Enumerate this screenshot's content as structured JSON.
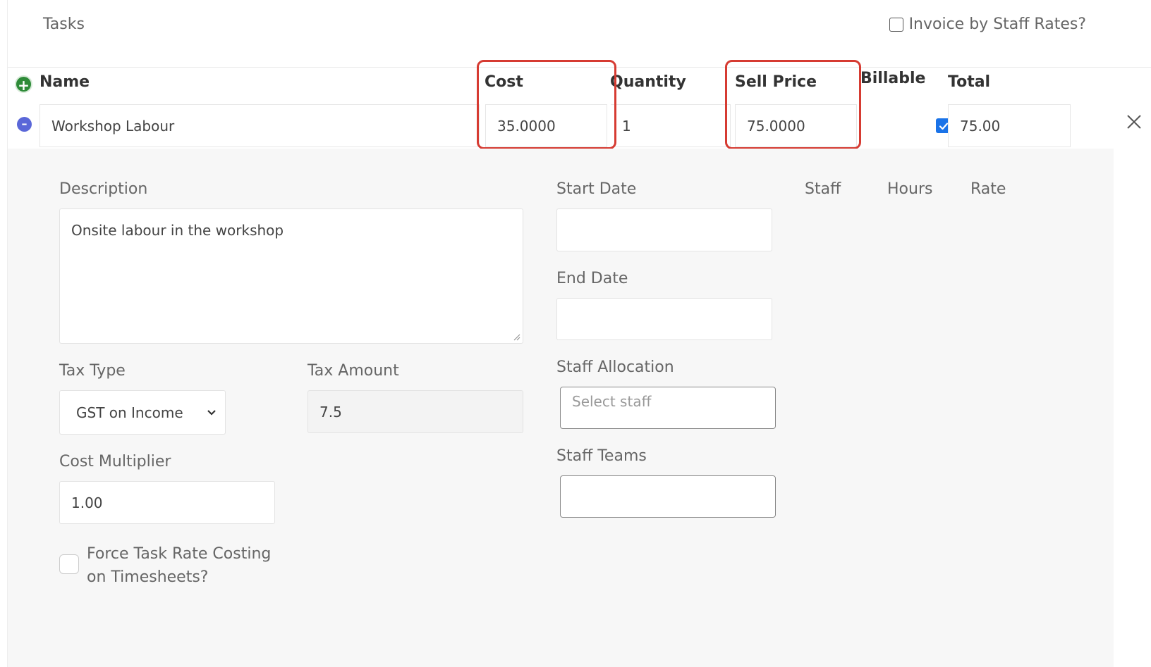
{
  "header": {
    "title": "Tasks",
    "invoice_by_staff_label": "Invoice by Staff Rates?"
  },
  "columns": {
    "name": "Name",
    "cost": "Cost",
    "quantity": "Quantity",
    "sell_price": "Sell Price",
    "billable": "Billable",
    "total": "Total"
  },
  "task_row": {
    "name": "Workshop Labour",
    "cost": "35.0000",
    "quantity": "1",
    "sell_price": "75.0000",
    "billable": true,
    "total": "75.00"
  },
  "details": {
    "description_label": "Description",
    "description_value": "Onsite labour in the workshop",
    "start_date_label": "Start Date",
    "end_date_label": "End Date",
    "staff_label": "Staff",
    "hours_label": "Hours",
    "rate_label": "Rate",
    "tax_type_label": "Tax Type",
    "tax_type_value": "GST on Income",
    "tax_amount_label": "Tax Amount",
    "tax_amount_value": "7.5",
    "staff_allocation_label": "Staff Allocation",
    "staff_allocation_placeholder": "Select staff",
    "cost_multiplier_label": "Cost Multiplier",
    "cost_multiplier_value": "1.00",
    "staff_teams_label": "Staff Teams",
    "force_rate_label_line1": "Force Task Rate Costing",
    "force_rate_label_line2": "on Timesheets?"
  },
  "colors": {
    "highlight": "#d63b32",
    "add_icon": "#2e8b38",
    "remove_icon": "#5a67d8",
    "checkbox_checked": "#1a73e8"
  },
  "icons": {
    "add": "plus-circle-icon",
    "remove": "minus-circle-icon",
    "close": "close-icon",
    "chevron": "chevron-down-icon",
    "check": "checkmark-icon"
  }
}
